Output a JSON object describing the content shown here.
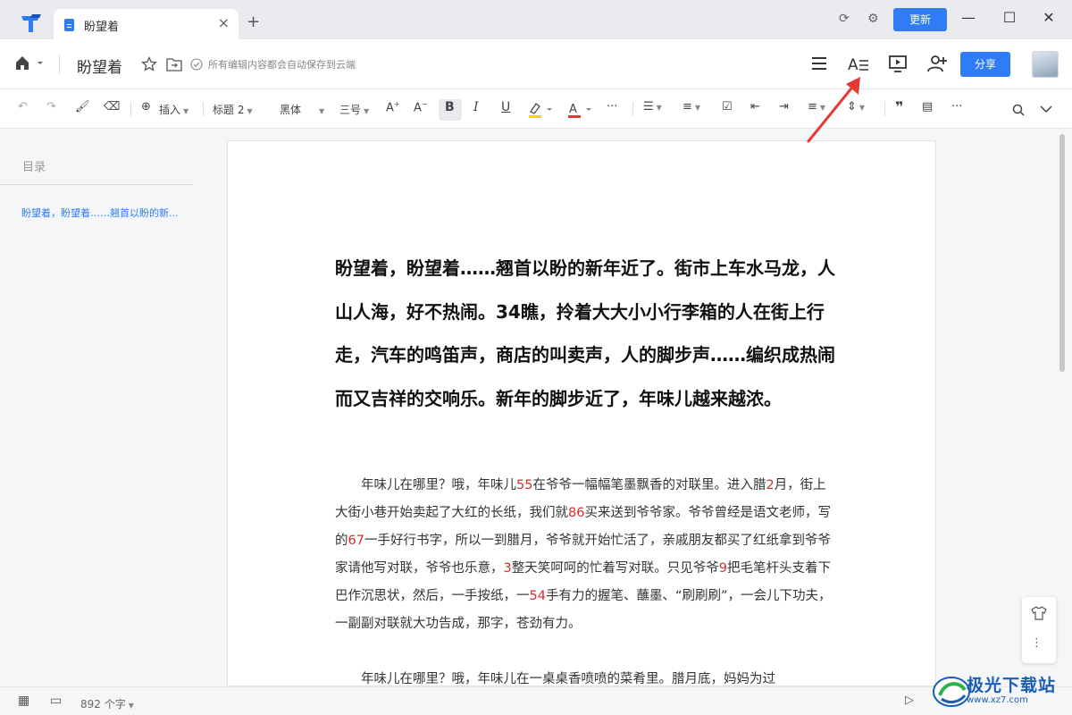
{
  "titlebar": {
    "tab_title": "盼望着",
    "new_tab": "+",
    "update_label": "更新"
  },
  "header": {
    "doc_name": "盼望着",
    "save_status": "所有编辑内容都会自动保存到云端",
    "share_label": "分享"
  },
  "toolbar": {
    "insert_label": "插入",
    "heading_style": "标题 2",
    "font_family": "黑体",
    "font_size": "三号",
    "bold": "B",
    "italic": "I",
    "underline": "U",
    "more": "···"
  },
  "sidebar": {
    "toc_title": "目录",
    "toc_item": "盼望着，盼望着……翘首以盼的新..."
  },
  "document": {
    "heading": "盼望着，盼望着……翘首以盼的新年近了。街市上车水马龙，人山人海，好不热闹。34瞧，拎着大大小小行李箱的人在街上行走，汽车的鸣笛声，商店的叫卖声，人的脚步声……编织成热闹而又吉祥的交响乐。新年的脚步近了，年味儿越来越浓。",
    "para1": [
      {
        "t": "年味儿在哪里？哦，年味儿"
      },
      {
        "t": "55",
        "n": true
      },
      {
        "t": "在爷爷一幅幅笔墨飘香的对联里。进入腊"
      },
      {
        "t": "2",
        "n": true
      },
      {
        "t": "月，街上大街小巷开始卖起了大红的长纸，我们就"
      },
      {
        "t": "86",
        "n": true
      },
      {
        "t": "买来送到爷爷家。爷爷曾经是语文老师，写的"
      },
      {
        "t": "67",
        "n": true
      },
      {
        "t": "一手好行书字，所以一到腊月，爷爷就开始忙活了，亲戚朋友都买了红纸拿到爷爷家请他写对联，爷爷也乐意，"
      },
      {
        "t": "3",
        "n": true
      },
      {
        "t": "整天笑呵呵的忙着写对联。只见爷爷"
      },
      {
        "t": "9",
        "n": true
      },
      {
        "t": "把毛笔杆头支着下巴作沉思状，然后，一手按纸，一"
      },
      {
        "t": "54",
        "n": true
      },
      {
        "t": "手有力的握笔、蘸墨、“刷刷刷”，一会儿下功夫，一副副对联就大功告成，那字，苍劲有力。"
      }
    ],
    "para2": "年味儿在哪里？哦，年味儿在一桌桌香喷喷的菜肴里。腊月底，妈妈为过"
  },
  "statusbar": {
    "word_count": "892 个字"
  },
  "watermark": {
    "text": "极光下载站",
    "sub": "www.xz7.com"
  },
  "colors": {
    "accent": "#2f7cf6",
    "number_red": "#d32f2f",
    "annotation": "#e53935"
  }
}
